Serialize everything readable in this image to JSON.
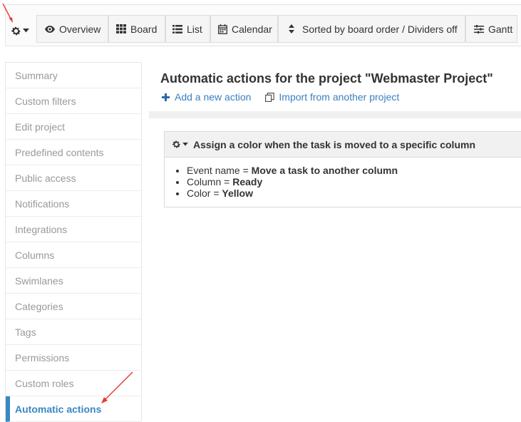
{
  "toolbar": {
    "items": [
      {
        "label": "Overview",
        "icon": "eye-icon"
      },
      {
        "label": "Board",
        "icon": "grid-icon"
      },
      {
        "label": "List",
        "icon": "list-icon"
      },
      {
        "label": "Calendar",
        "icon": "calendar-icon"
      },
      {
        "label": "Sorted by board order / Dividers off",
        "icon": "sort-icon"
      },
      {
        "label": "Gantt",
        "icon": "sliders-icon"
      }
    ]
  },
  "sidebar": {
    "items": [
      {
        "label": "Summary"
      },
      {
        "label": "Custom filters"
      },
      {
        "label": "Edit project"
      },
      {
        "label": "Predefined contents"
      },
      {
        "label": "Public access"
      },
      {
        "label": "Notifications"
      },
      {
        "label": "Integrations"
      },
      {
        "label": "Columns"
      },
      {
        "label": "Swimlanes"
      },
      {
        "label": "Categories"
      },
      {
        "label": "Tags"
      },
      {
        "label": "Permissions"
      },
      {
        "label": "Custom roles"
      },
      {
        "label": "Automatic actions"
      }
    ],
    "active": "Automatic actions"
  },
  "main": {
    "title": "Automatic actions for the project \"Webmaster Project\"",
    "add_action": "Add a new action",
    "import_action": "Import from another project",
    "card": {
      "title": "Assign a color when the task is moved to a specific column",
      "params": [
        {
          "key": "Event name = ",
          "value": "Move a task to another column"
        },
        {
          "key": "Column = ",
          "value": "Ready"
        },
        {
          "key": "Color = ",
          "value": "Yellow"
        }
      ]
    }
  },
  "colors": {
    "accent": "#3a87c2",
    "link": "#3a7fc0",
    "annotation_arrow": "#e53935"
  }
}
